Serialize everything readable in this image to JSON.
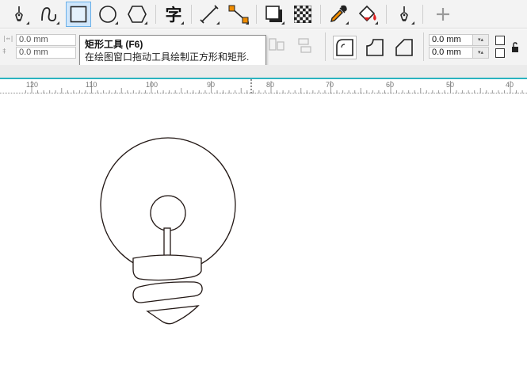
{
  "toolbar": {
    "tools": [
      {
        "name": "freehand-tool",
        "icon": "pen-nib-icon"
      },
      {
        "name": "curve-tool",
        "icon": "curve-icon"
      },
      {
        "name": "rectangle-tool",
        "icon": "rectangle-icon",
        "active": true
      },
      {
        "name": "ellipse-tool",
        "icon": "ellipse-icon"
      },
      {
        "name": "polygon-tool",
        "icon": "hexagon-icon"
      },
      {
        "name": "text-tool",
        "icon": "text-icon",
        "glyph": "字"
      },
      {
        "name": "dimension-tool",
        "icon": "dimension-line-icon"
      },
      {
        "name": "connector-tool",
        "icon": "connector-icon"
      },
      {
        "name": "shadow-tool",
        "icon": "drop-shadow-icon"
      },
      {
        "name": "transparency-tool",
        "icon": "checkerboard-icon"
      },
      {
        "name": "eyedropper-tool",
        "icon": "eyedropper-icon"
      },
      {
        "name": "fill-tool",
        "icon": "paint-bucket-icon"
      },
      {
        "name": "outline-pen-tool",
        "icon": "pen-nib-icon"
      },
      {
        "name": "add-tool-button",
        "icon": "plus-icon"
      }
    ],
    "accent_color": "#6ab0e8",
    "fill_red": "#e02020",
    "fill_orange": "#f08c00"
  },
  "propbar": {
    "width_value": "0.0 mm",
    "height_value": "0.0 mm",
    "corner_radius_top": "0.0 mm",
    "corner_radius_bottom": "0.0 mm"
  },
  "tooltip": {
    "title": "矩形工具 (F6)",
    "description": "在绘图窗口拖动工具绘制正方形和矩形."
  },
  "ruler": {
    "labels": [
      "120",
      "110",
      "100",
      "90",
      "80",
      "70",
      "60",
      "50",
      "40"
    ],
    "accent_color": "#2bb3c0"
  }
}
